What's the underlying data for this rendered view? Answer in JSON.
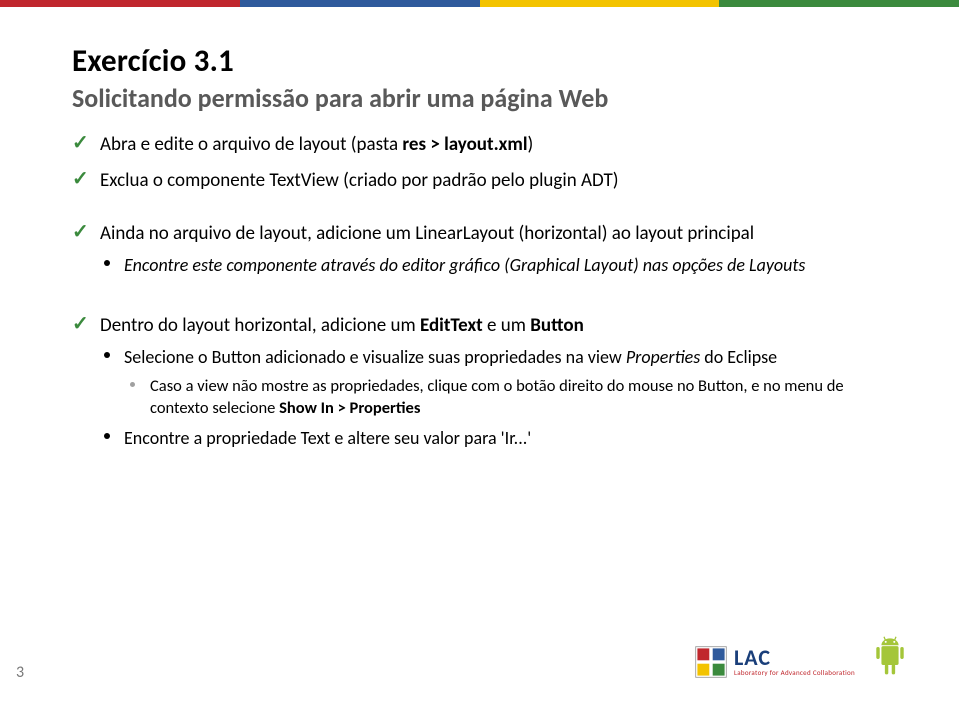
{
  "title": "Exercício 3.1",
  "subtitle": "Solicitando permissão para abrir uma página Web",
  "items": {
    "i1_pre": "Abra e edite o arquivo de layout (pasta ",
    "i1_bold": "res > layout.xml",
    "i1_post": ")",
    "i2": "Exclua o componente TextView (criado por padrão pelo plugin ADT)"
  },
  "items2": {
    "i3": "Ainda no arquivo de layout, adicione um LinearLayout (horizontal) ao layout principal",
    "i3_sub": "Encontre este componente através do editor gráfico (Graphical Layout) nas opções de Layouts"
  },
  "items3": {
    "i4_pre": "Dentro do layout horizontal, adicione um ",
    "i4_b1": "EditText",
    "i4_mid": " e um ",
    "i4_b2": "Button",
    "i4_sub_pre": "Selecione o Button adicionado e visualize suas propriedades na view ",
    "i4_sub_it": "Properties",
    "i4_sub_post": " do Eclipse",
    "i4_sub2_pre": "Caso a view não mostre as propriedades, clique com o botão direito do mouse no Button, e no menu de contexto selecione ",
    "i4_sub2_b": "Show In > Properties",
    "i4_sub3": "Encontre a propriedade Text e altere seu valor para 'Ir...'"
  },
  "page_number": "3",
  "logo": {
    "name": "LAC",
    "tagline": "Laboratory for Advanced Collaboration"
  }
}
